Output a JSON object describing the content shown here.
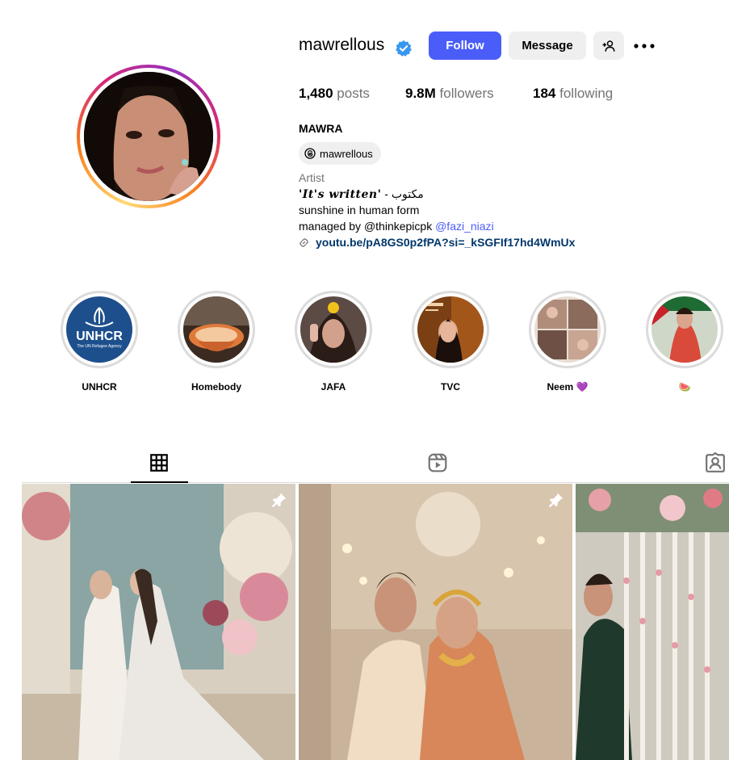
{
  "profile": {
    "username": "mawrellous",
    "follow_label": "Follow",
    "message_label": "Message",
    "stats": {
      "posts_count": "1,480",
      "posts_label": "posts",
      "followers_count": "9.8M",
      "followers_label": "followers",
      "following_count": "184",
      "following_label": "following"
    },
    "full_name": "MAWRA",
    "threads_handle": "mawrellous",
    "category": "Artist",
    "bio": {
      "line1_script": "'It's written'",
      "line1_rest": " - مكتوب",
      "line2": "sunshine in human form",
      "line3_prefix": "managed by @thinkepicpk ",
      "line3_mention": "@fazi_niazi",
      "link": "youtu.be/pA8GS0p2fPA?si=_kSGFIf17hd4WmUx"
    }
  },
  "highlights": [
    {
      "label": "UNHCR"
    },
    {
      "label": "Homebody"
    },
    {
      "label": "JAFA"
    },
    {
      "label": "TVC"
    },
    {
      "label": "Neem 💜"
    },
    {
      "label": "🍉"
    }
  ],
  "highlight_art": {
    "unhcr_text": "UNHCR",
    "unhcr_sub": "The UN Refugee Agency"
  },
  "tabs": [
    "grid-icon",
    "reels-icon",
    "tagged-icon"
  ],
  "colors": {
    "accent": "#4a5df9",
    "link": "#00376b",
    "muted": "#737373"
  }
}
